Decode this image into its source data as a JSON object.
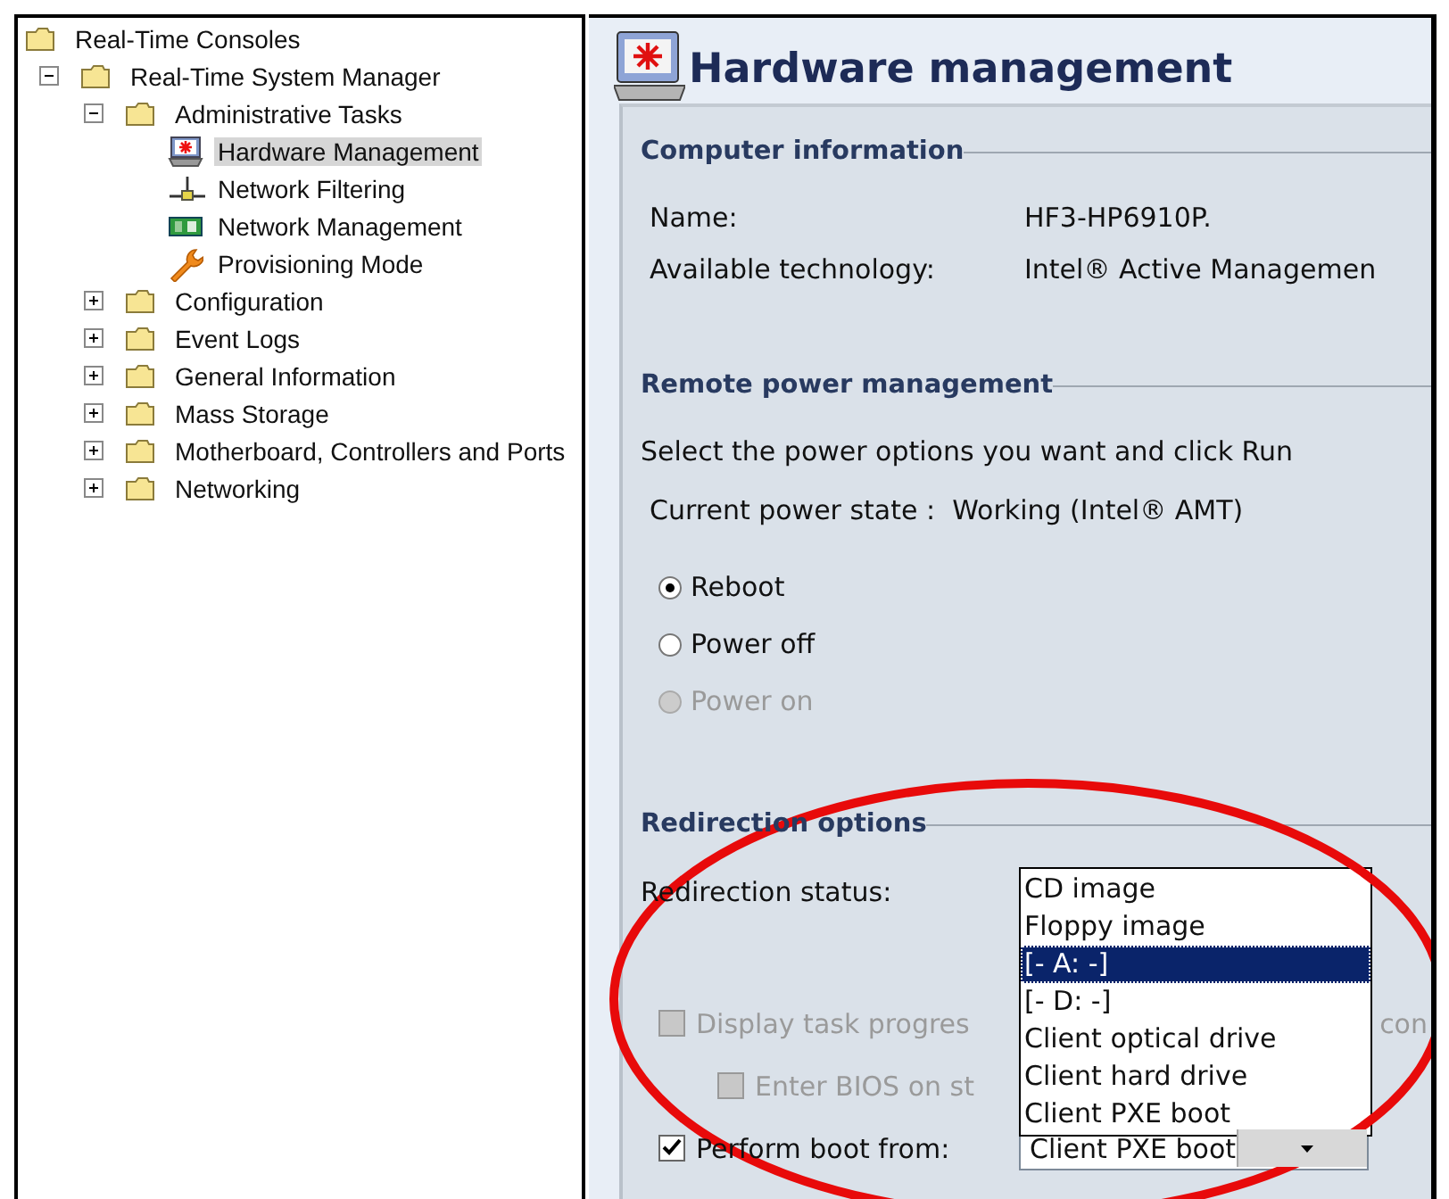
{
  "tree": [
    {
      "label": "Real-Time Consoles",
      "kind": "folder",
      "selected": false,
      "children": [
        {
          "label": "Real-Time System Manager",
          "kind": "folder",
          "expanded": true,
          "selected": false,
          "children": [
            {
              "label": "Administrative Tasks",
              "kind": "folder",
              "expanded": true,
              "selected": false,
              "children": [
                {
                  "label": "Hardware Management",
                  "kind": "monitor",
                  "selected": true
                },
                {
                  "label": "Network Filtering",
                  "kind": "network",
                  "selected": false
                },
                {
                  "label": "Network Management",
                  "kind": "board",
                  "selected": false
                },
                {
                  "label": "Provisioning Mode",
                  "kind": "wrench",
                  "selected": false
                }
              ]
            },
            {
              "label": "Configuration",
              "kind": "folder",
              "expanded": false,
              "selected": false
            },
            {
              "label": "Event Logs",
              "kind": "folder",
              "expanded": false,
              "selected": false
            },
            {
              "label": "General Information",
              "kind": "folder",
              "expanded": false,
              "selected": false
            },
            {
              "label": "Mass Storage",
              "kind": "folder",
              "expanded": false,
              "selected": false
            },
            {
              "label": "Motherboard, Controllers and Ports",
              "kind": "folder",
              "expanded": false,
              "selected": false
            },
            {
              "label": "Networking",
              "kind": "folder",
              "expanded": false,
              "selected": false
            }
          ]
        }
      ]
    }
  ],
  "page": {
    "title": "Hardware management"
  },
  "computer_info": {
    "heading": "Computer information",
    "fields": [
      {
        "label": "Name:",
        "value": "HF3-HP6910P."
      },
      {
        "label": "Available technology:",
        "value": "Intel® Active Managemen"
      }
    ]
  },
  "power": {
    "heading": "Remote power management",
    "instruction": "Select the power options you want and click Run",
    "state": "Current power state :  Working (Intel® AMT)",
    "options": [
      {
        "label": "Reboot",
        "selected": true,
        "disabled": false
      },
      {
        "label": "Power off",
        "selected": false,
        "disabled": false
      },
      {
        "label": "Power on",
        "selected": false,
        "disabled": true
      }
    ]
  },
  "redirection": {
    "heading": "Redirection options",
    "status_label": "Redirection status:",
    "checkboxes": [
      {
        "label": "Display task progres",
        "after": "con",
        "checked": false,
        "disabled": true,
        "indent": false
      },
      {
        "label": "Enter BIOS on st",
        "checked": false,
        "disabled": true,
        "indent": true
      }
    ],
    "boot": {
      "label": "Perform boot from:",
      "checked": true,
      "value": "Client PXE boot"
    },
    "dropdown": [
      {
        "label": "CD image",
        "selected": false
      },
      {
        "label": "Floppy image",
        "selected": false
      },
      {
        "label": "[- A: -]",
        "selected": true
      },
      {
        "label": "[- D: -]",
        "selected": false
      },
      {
        "label": "Client optical drive",
        "selected": false
      },
      {
        "label": "Client hard drive",
        "selected": false
      },
      {
        "label": "Client PXE boot",
        "selected": false
      }
    ]
  }
}
